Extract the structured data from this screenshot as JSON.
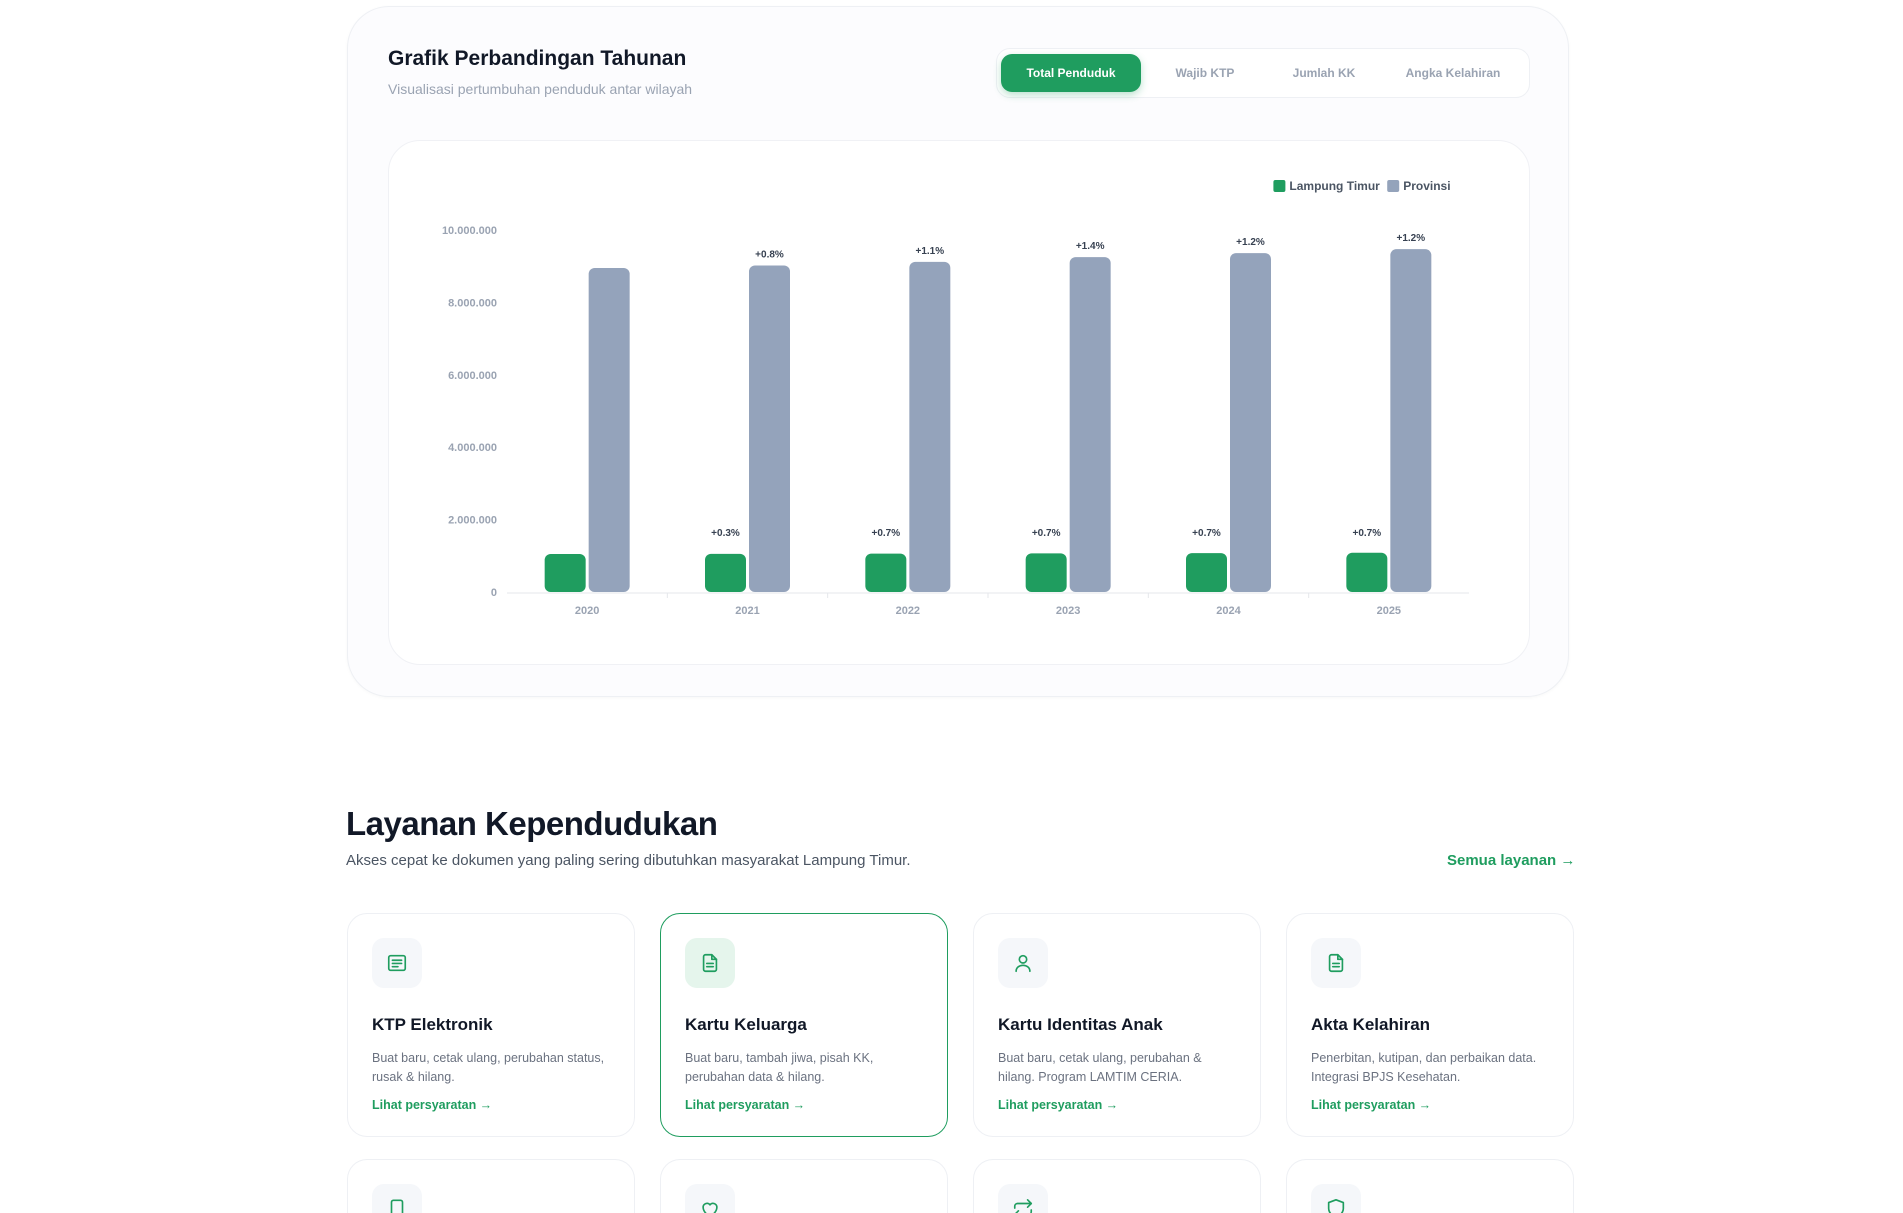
{
  "chart_section": {
    "title": "Grafik Perbandingan Tahunan",
    "subtitle": "Visualisasi pertumbuhan penduduk antar wilayah",
    "tabs": [
      {
        "label": "Total Penduduk",
        "active": true
      },
      {
        "label": "Wajib KTP",
        "active": false
      },
      {
        "label": "Jumlah KK",
        "active": false
      },
      {
        "label": "Angka Kelahiran",
        "active": false
      }
    ]
  },
  "chart_data": {
    "type": "bar",
    "categories": [
      "2020",
      "2021",
      "2022",
      "2023",
      "2024",
      "2025"
    ],
    "ylim": [
      0,
      10000000
    ],
    "yticks": [
      "0",
      "2.000.000",
      "4.000.000",
      "6.000.000",
      "8.000.000",
      "10.000.000"
    ],
    "legend_position": "top-right",
    "series": [
      {
        "name": "Lampung Timur",
        "color": "#1f9d5f",
        "values": [
          1050000,
          1053000,
          1060000,
          1068000,
          1075000,
          1083000
        ],
        "labels": [
          "",
          "+0.3%",
          "+0.7%",
          "+0.7%",
          "+0.7%",
          "+0.7%"
        ]
      },
      {
        "name": "Provinsi",
        "color": "#94a3bb",
        "values": [
          8950000,
          9020000,
          9120000,
          9250000,
          9360000,
          9470000
        ],
        "labels": [
          "",
          "+0.8%",
          "+1.1%",
          "+1.4%",
          "+1.2%",
          "+1.2%"
        ]
      }
    ]
  },
  "services": {
    "title": "Layanan Kependudukan",
    "description": "Akses cepat ke dokumen yang paling sering dibutuhkan masyarakat Lampung Timur.",
    "all_link": "Semua layanan →",
    "items": [
      {
        "icon": "id-card-icon",
        "title": "KTP Elektronik",
        "desc": "Buat baru, cetak ulang, perubahan status, rusak & hilang.",
        "link": "Lihat persyaratan →"
      },
      {
        "icon": "document-icon",
        "title": "Kartu Keluarga",
        "desc": "Buat baru, tambah jiwa, pisah KK, perubahan data & hilang.",
        "link": "Lihat persyaratan →"
      },
      {
        "icon": "user-icon",
        "title": "Kartu Identitas Anak",
        "desc": "Buat baru, cetak ulang, perubahan & hilang. Program LAMTIM CERIA.",
        "link": "Lihat persyaratan →"
      },
      {
        "icon": "document-icon",
        "title": "Akta Kelahiran",
        "desc": "Penerbitan, kutipan, dan perbaikan data. Integrasi BPJS Kesehatan.",
        "link": "Lihat persyaratan →"
      }
    ],
    "second_row_icons": [
      "smartphone-icon",
      "heart-icon",
      "repeat-icon",
      "shield-icon"
    ],
    "accent_color": "#1f9d5f"
  }
}
